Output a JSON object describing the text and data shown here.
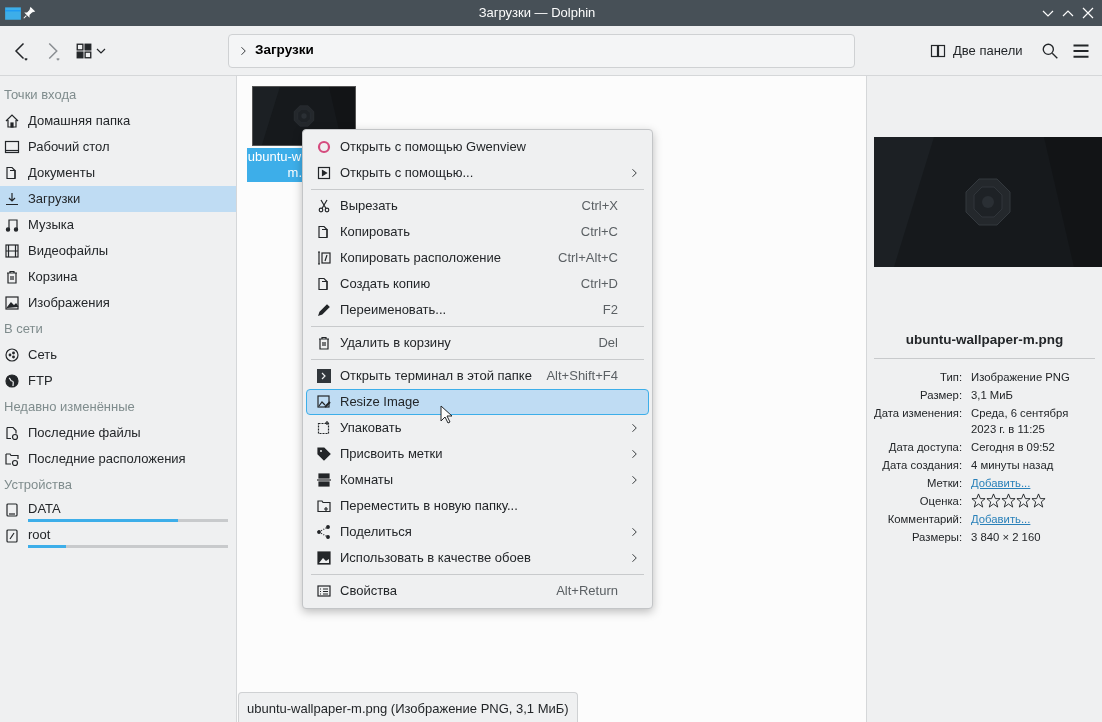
{
  "window": {
    "title": "Загрузки — Dolphin"
  },
  "toolbar": {
    "breadcrumb": "Загрузки",
    "split_button": "Две панели"
  },
  "sidebar": {
    "sections": [
      {
        "title": "Точки входа",
        "items": [
          {
            "label": "Домашняя папка",
            "selected": false
          },
          {
            "label": "Рабочий стол",
            "selected": false
          },
          {
            "label": "Документы",
            "selected": false
          },
          {
            "label": "Загрузки",
            "selected": true
          },
          {
            "label": "Музыка",
            "selected": false
          },
          {
            "label": "Видеофайлы",
            "selected": false
          },
          {
            "label": "Корзина",
            "selected": false
          },
          {
            "label": "Изображения",
            "selected": false
          }
        ]
      },
      {
        "title": "В сети",
        "items": [
          {
            "label": "Сеть",
            "selected": false
          },
          {
            "label": "FTP",
            "selected": false
          }
        ]
      },
      {
        "title": "Недавно изменённые",
        "items": [
          {
            "label": "Последние файлы",
            "selected": false
          },
          {
            "label": "Последние расположения",
            "selected": false
          }
        ]
      },
      {
        "title": "Устройства",
        "items": [
          {
            "label": "DATA",
            "selected": false,
            "level": 0.75
          },
          {
            "label": "root",
            "selected": false,
            "level": 0.19
          }
        ]
      }
    ]
  },
  "files": [
    {
      "lines": [
        "ubuntu-w",
        "m."
      ],
      "selected": true
    }
  ],
  "context_menu": {
    "items": [
      {
        "kind": "item",
        "label": "Открыть с помощью Gwenview",
        "submenu": false,
        "selected": false
      },
      {
        "kind": "item",
        "label": "Открыть с помощью...",
        "submenu": true,
        "selected": false
      },
      {
        "kind": "separator"
      },
      {
        "kind": "item",
        "label": "Вырезать",
        "shortcut": "Ctrl+X",
        "submenu": false,
        "selected": false
      },
      {
        "kind": "item",
        "label": "Копировать",
        "shortcut": "Ctrl+C",
        "submenu": false,
        "selected": false
      },
      {
        "kind": "item",
        "label": "Копировать расположение",
        "shortcut": "Ctrl+Alt+C",
        "submenu": false,
        "selected": false
      },
      {
        "kind": "item",
        "label": "Создать копию",
        "shortcut": "Ctrl+D",
        "submenu": false,
        "selected": false
      },
      {
        "kind": "item",
        "label": "Переименовать...",
        "shortcut": "F2",
        "submenu": false,
        "selected": false
      },
      {
        "kind": "separator"
      },
      {
        "kind": "item",
        "label": "Удалить в корзину",
        "shortcut": "Del",
        "submenu": false,
        "selected": false
      },
      {
        "kind": "separator"
      },
      {
        "kind": "item",
        "label": "Открыть терминал в этой папке",
        "shortcut": "Alt+Shift+F4",
        "submenu": false,
        "selected": false
      },
      {
        "kind": "item",
        "label": "Resize Image",
        "submenu": false,
        "selected": true
      },
      {
        "kind": "item",
        "label": "Упаковать",
        "submenu": true,
        "selected": false
      },
      {
        "kind": "item",
        "label": "Присвоить метки",
        "submenu": true,
        "selected": false
      },
      {
        "kind": "item",
        "label": "Комнаты",
        "submenu": true,
        "selected": false
      },
      {
        "kind": "item",
        "label": "Переместить в новую папку...",
        "submenu": false,
        "selected": false
      },
      {
        "kind": "item",
        "label": "Поделиться",
        "submenu": true,
        "selected": false
      },
      {
        "kind": "item",
        "label": "Использовать в качестве обоев",
        "submenu": true,
        "selected": false
      },
      {
        "kind": "separator"
      },
      {
        "kind": "item",
        "label": "Свойства",
        "shortcut": "Alt+Return",
        "submenu": false,
        "selected": false
      }
    ]
  },
  "info_panel": {
    "filename": "ubuntu-wallpaper-m.png",
    "fields": [
      {
        "kind": "text",
        "label": "Тип:",
        "value": "Изображение PNG"
      },
      {
        "kind": "text",
        "label": "Размер:",
        "value": "3,1 МиБ"
      },
      {
        "kind": "text",
        "label": "Дата изменения:",
        "value": "Среда, 6 сентября 2023 г. в 11:25"
      },
      {
        "kind": "text",
        "label": "Дата доступа:",
        "value": "Сегодня в 09:52"
      },
      {
        "kind": "text",
        "label": "Дата создания:",
        "value": "4 минуты назад"
      },
      {
        "kind": "link",
        "label": "Метки:",
        "value": "Добавить..."
      },
      {
        "kind": "stars",
        "label": "Оценка:",
        "stars": 0
      },
      {
        "kind": "link",
        "label": "Комментарий:",
        "value": "Добавить..."
      },
      {
        "kind": "text",
        "label": "Размеры:",
        "value": "3 840 × 2 160"
      }
    ]
  },
  "status_bar": {
    "text": "ubuntu-wallpaper-m.png (Изображение PNG, 3,1 МиБ)"
  }
}
